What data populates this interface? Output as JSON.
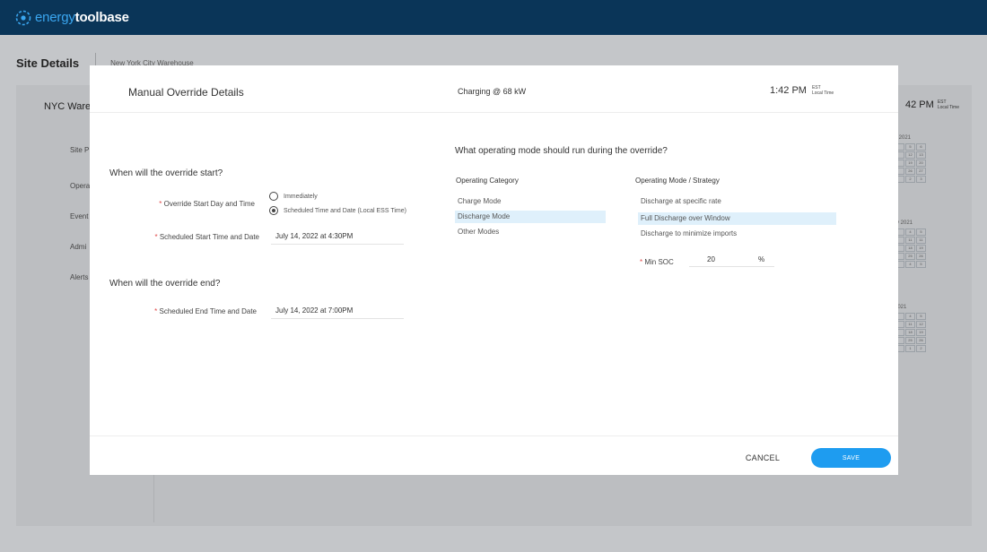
{
  "app": {
    "logo_text_a": "energy",
    "logo_text_b": "toolbase"
  },
  "background": {
    "title": "Site Details",
    "subtitle": "New York City Warehouse",
    "card_title": "NYC Ware",
    "time": "42 PM",
    "tz": "EST",
    "tz_sub": "Local Time",
    "nav": [
      "Site P",
      "Opera",
      "Event",
      "Admi",
      "Alerts"
    ],
    "calendars": [
      {
        "label": "y 2021",
        "cells": [
          "",
          "5",
          "6",
          "",
          "12",
          "13",
          "",
          "19",
          "20",
          "",
          "26",
          "27",
          "",
          "2",
          "3"
        ]
      },
      {
        "label": "ry 2021",
        "cells": [
          "",
          "4",
          "5",
          "",
          "11",
          "11",
          "",
          "18",
          "19",
          "",
          "25",
          "26",
          "",
          "4",
          "5"
        ]
      },
      {
        "label": "2021",
        "cells": [
          "",
          "4",
          "5",
          "",
          "11",
          "12",
          "",
          "18",
          "19",
          "",
          "25",
          "26",
          "",
          "1",
          "2"
        ]
      }
    ]
  },
  "modal": {
    "title": "Manual Override Details",
    "status": "Charging @ 68 kW",
    "time": "1:42 PM",
    "tz": "EST",
    "tz_sub": "Local Time",
    "start_section": "When will the override start?",
    "start_day_label": "Override Start Day and Time",
    "radio_immediately": "Immediately",
    "radio_scheduled": "Scheduled Time and Date (Local ESS Time)",
    "start_time_label": "Scheduled Start Time and Date",
    "start_time_value": "July 14, 2022 at 4:30PM",
    "end_section": "When will the override end?",
    "end_time_label": "Scheduled End Time and Date",
    "end_time_value": "July 14, 2022 at 7:00PM",
    "mode_question": "What operating mode should run during the override?",
    "category_header": "Operating Category",
    "categories": [
      "Charge Mode",
      "Discharge Mode",
      "Other Modes"
    ],
    "strategy_header": "Operating Mode / Strategy",
    "strategies": [
      "Discharge at specific rate",
      "Full Discharge over Window",
      "Discharge to minimize imports"
    ],
    "soc_label": "Min SOC",
    "soc_value": "20",
    "soc_unit": "%",
    "required_mark": "*",
    "cancel_label": "CANCEL",
    "save_label": "SAVE"
  }
}
